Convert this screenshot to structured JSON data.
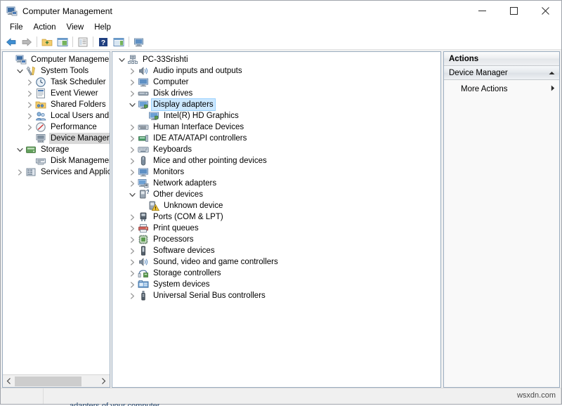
{
  "window": {
    "title": "Computer Management",
    "app_icon": "computer-management-icon",
    "controls": {
      "minimize": "minimize-icon",
      "maximize": "maximize-icon",
      "close": "close-icon"
    }
  },
  "menubar": {
    "items": [
      {
        "label": "File"
      },
      {
        "label": "Action"
      },
      {
        "label": "View"
      },
      {
        "label": "Help"
      }
    ]
  },
  "toolbar": {
    "buttons": [
      {
        "name": "back-icon"
      },
      {
        "name": "forward-icon"
      },
      {
        "name": "up-folder-icon"
      },
      {
        "name": "show-hide-console-tree-icon"
      },
      {
        "name": "properties-icon"
      },
      {
        "name": "help-icon"
      },
      {
        "name": "show-hide-action-pane-icon"
      },
      {
        "name": "scan-hardware-changes-icon"
      }
    ]
  },
  "console_tree": {
    "items": [
      {
        "label": "Computer Management (Local",
        "indent": 0,
        "twisty": "none",
        "icon": "computer-management-icon",
        "state": "none"
      },
      {
        "label": "System Tools",
        "indent": 1,
        "twisty": "expanded",
        "icon": "system-tools-icon",
        "state": "none"
      },
      {
        "label": "Task Scheduler",
        "indent": 2,
        "twisty": "collapsed",
        "icon": "clock-icon",
        "state": "none"
      },
      {
        "label": "Event Viewer",
        "indent": 2,
        "twisty": "collapsed",
        "icon": "event-viewer-icon",
        "state": "none"
      },
      {
        "label": "Shared Folders",
        "indent": 2,
        "twisty": "collapsed",
        "icon": "shared-folders-icon",
        "state": "none"
      },
      {
        "label": "Local Users and Groups",
        "indent": 2,
        "twisty": "collapsed",
        "icon": "users-icon",
        "state": "none"
      },
      {
        "label": "Performance",
        "indent": 2,
        "twisty": "collapsed",
        "icon": "performance-icon",
        "state": "none"
      },
      {
        "label": "Device Manager",
        "indent": 2,
        "twisty": "none",
        "icon": "device-manager-icon",
        "state": "selected-inactive"
      },
      {
        "label": "Storage",
        "indent": 1,
        "twisty": "expanded",
        "icon": "storage-icon",
        "state": "none"
      },
      {
        "label": "Disk Management",
        "indent": 2,
        "twisty": "none",
        "icon": "disk-management-icon",
        "state": "none"
      },
      {
        "label": "Services and Applications",
        "indent": 1,
        "twisty": "collapsed",
        "icon": "services-icon",
        "state": "none"
      }
    ]
  },
  "device_tree": {
    "items": [
      {
        "label": "PC-33Srishti",
        "indent": 0,
        "twisty": "expanded",
        "icon": "computer-root-icon",
        "state": "none"
      },
      {
        "label": "Audio inputs and outputs",
        "indent": 1,
        "twisty": "collapsed",
        "icon": "speaker-icon",
        "state": "none"
      },
      {
        "label": "Computer",
        "indent": 1,
        "twisty": "collapsed",
        "icon": "monitor-icon",
        "state": "none"
      },
      {
        "label": "Disk drives",
        "indent": 1,
        "twisty": "collapsed",
        "icon": "disk-drive-icon",
        "state": "none"
      },
      {
        "label": "Display adapters",
        "indent": 1,
        "twisty": "expanded",
        "icon": "display-adapter-icon",
        "state": "selected-active"
      },
      {
        "label": "Intel(R) HD Graphics",
        "indent": 2,
        "twisty": "none",
        "icon": "display-adapter-icon",
        "state": "none"
      },
      {
        "label": "Human Interface Devices",
        "indent": 1,
        "twisty": "collapsed",
        "icon": "hid-icon",
        "state": "none"
      },
      {
        "label": "IDE ATA/ATAPI controllers",
        "indent": 1,
        "twisty": "collapsed",
        "icon": "ide-controller-icon",
        "state": "none"
      },
      {
        "label": "Keyboards",
        "indent": 1,
        "twisty": "collapsed",
        "icon": "keyboard-icon",
        "state": "none"
      },
      {
        "label": "Mice and other pointing devices",
        "indent": 1,
        "twisty": "collapsed",
        "icon": "mouse-icon",
        "state": "none"
      },
      {
        "label": "Monitors",
        "indent": 1,
        "twisty": "collapsed",
        "icon": "monitor-icon",
        "state": "none"
      },
      {
        "label": "Network adapters",
        "indent": 1,
        "twisty": "collapsed",
        "icon": "network-adapter-icon",
        "state": "none"
      },
      {
        "label": "Other devices",
        "indent": 1,
        "twisty": "expanded",
        "icon": "other-devices-icon",
        "state": "none"
      },
      {
        "label": "Unknown device",
        "indent": 2,
        "twisty": "none",
        "icon": "unknown-device-warning-icon",
        "state": "none"
      },
      {
        "label": "Ports (COM & LPT)",
        "indent": 1,
        "twisty": "collapsed",
        "icon": "port-icon",
        "state": "none"
      },
      {
        "label": "Print queues",
        "indent": 1,
        "twisty": "collapsed",
        "icon": "printer-icon",
        "state": "none"
      },
      {
        "label": "Processors",
        "indent": 1,
        "twisty": "collapsed",
        "icon": "processor-icon",
        "state": "none"
      },
      {
        "label": "Software devices",
        "indent": 1,
        "twisty": "collapsed",
        "icon": "software-device-icon",
        "state": "none"
      },
      {
        "label": "Sound, video and game controllers",
        "indent": 1,
        "twisty": "collapsed",
        "icon": "speaker-icon",
        "state": "none"
      },
      {
        "label": "Storage controllers",
        "indent": 1,
        "twisty": "collapsed",
        "icon": "storage-controller-icon",
        "state": "none"
      },
      {
        "label": "System devices",
        "indent": 1,
        "twisty": "collapsed",
        "icon": "system-device-icon",
        "state": "none"
      },
      {
        "label": "Universal Serial Bus controllers",
        "indent": 1,
        "twisty": "collapsed",
        "icon": "usb-icon",
        "state": "none"
      }
    ]
  },
  "actions_pane": {
    "header": "Actions",
    "group_label": "Device Manager",
    "group_chevron": "chevron-up-icon",
    "items": [
      {
        "label": "More Actions",
        "submenu_icon": "chevron-right-icon"
      }
    ]
  },
  "statusbar": {
    "cutoff_text": "adapters of your computer",
    "watermark": "wsxdn.com"
  },
  "colors": {
    "selection_active": "#cce8ff",
    "selection_inactive": "#d8d8d8",
    "pane_border": "#9badc0",
    "window_bg": "#f0f0f0"
  }
}
